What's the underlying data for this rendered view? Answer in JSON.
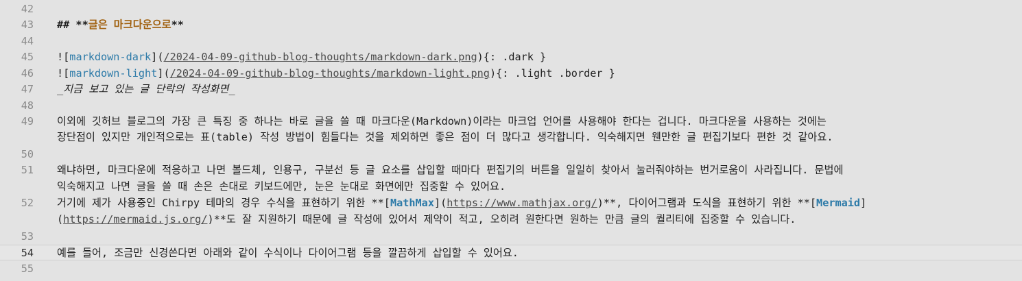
{
  "editor": {
    "lines": [
      {
        "num": "42"
      },
      {
        "num": "43",
        "heading_marker": "## **",
        "heading_text": "글은 마크다운으로",
        "heading_end": "**"
      },
      {
        "num": "44"
      },
      {
        "num": "45",
        "p1": "![",
        "alt": "markdown-dark",
        "p2": "](",
        "url": "/2024-04-09-github-blog-thoughts/markdown-dark.png",
        "p3": "){: .dark }"
      },
      {
        "num": "46",
        "p1": "![",
        "alt": "markdown-light",
        "p2": "](",
        "url": "/2024-04-09-github-blog-thoughts/markdown-light.png",
        "p3": "){: .light .border }"
      },
      {
        "num": "47",
        "text": "_지금 보고 있는 글 단락의 작성화면_"
      },
      {
        "num": "48"
      },
      {
        "num": "49",
        "text": "이외에 깃허브 블로그의 가장 큰 특징 중 하나는 바로 글을 쓸 때 마크다운(Markdown)이라는 마크업 언어를 사용해야 한다는 겁니다. 마크다운을 사용하는 것에는",
        "wrap": "장단점이 있지만 개인적으로는 표(table) 작성 방법이 힘들다는 것을 제외하면 좋은 점이 더 많다고 생각합니다. 익숙해지면 웬만한 글 편집기보다 편한 것 같아요."
      },
      {
        "num": "50"
      },
      {
        "num": "51",
        "text": "왜냐하면, 마크다운에 적응하고 나면 볼드체, 인용구, 구분선 등 글 요소를 삽입할 때마다 편집기의 버튼을 일일히 찾아서 눌러줘야하는 번거로움이 사라집니다. 문법에",
        "wrap": "익숙해지고 나면 글을 쓸 때 손은 손대로 키보드에만, 눈은 눈대로 화면에만 집중할 수 있어요."
      },
      {
        "num": "52",
        "a": "거기에 제가 사용중인 Chirpy 테마의 경우 수식을 표현하기 위한 **[",
        "b": "MathMax",
        "c": "](",
        "d": "https://www.mathjax.org/",
        "e": ")**, 다이어그램과 도식을 표현하기 위한 **[",
        "f": "Mermaid",
        "g": "]",
        "h": "(",
        "i": "https://mermaid.js.org/",
        "j": ")**도 잘 지원하기 때문에 글 작성에 있어서 제약이 적고, 오히려 원한다면 원하는 만큼 글의 퀄리티에 집중할 수 있습니다."
      },
      {
        "num": "53"
      },
      {
        "num": "54",
        "text": "예를 들어, 조금만 신경쓴다면 아래와 같이 수식이나 다이어그램 등을 깔끔하게 삽입할 수 있어요."
      },
      {
        "num": "55"
      }
    ]
  }
}
